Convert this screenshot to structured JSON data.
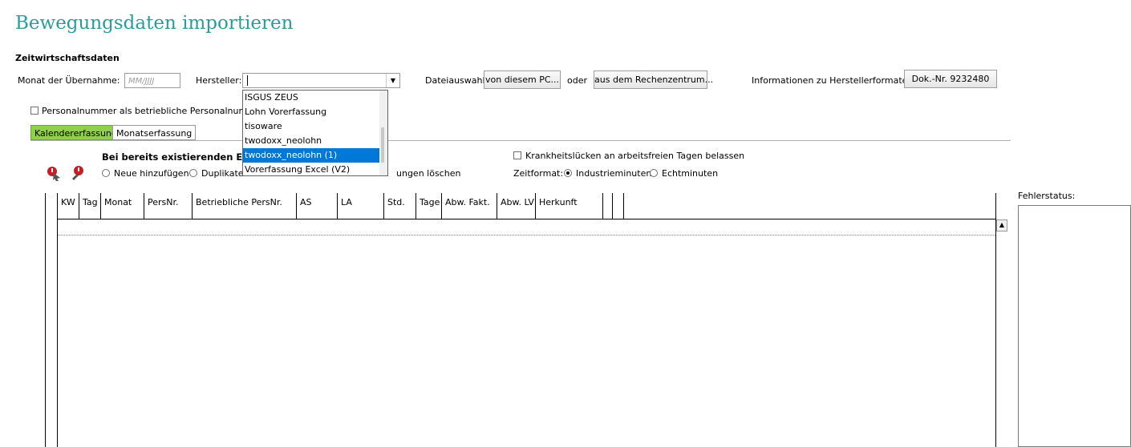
{
  "page": {
    "title": "Bewegungsdaten importieren",
    "section": "Zeitwirtschaftsdaten"
  },
  "form": {
    "month_label": "Monat der Übernahme:",
    "month_placeholder": "MM/JJJJ",
    "manufacturer_label": "Hersteller:",
    "file_label": "Dateiauswahl:",
    "from_pc_button": "von diesem PC...",
    "or_label": "oder",
    "from_datacenter_button": "aus dem Rechenzentrum...",
    "info_label": "Informationen zu Herstellerformaten:",
    "doc_button": "Dok.-Nr. 9232480",
    "persnr_checkbox": "Personalnummer als betriebliche Personalnummer imp"
  },
  "dropdown": {
    "items": [
      "ISGUS ZEUS",
      "Lohn Vorerfassung",
      "tisoware",
      "twodoxx_neolohn",
      "twodoxx_neolohn (1)",
      "Vorerfassung Excel (V2)"
    ],
    "selected_index": 4
  },
  "tabs": [
    {
      "label": "Kalendererfassung",
      "active": true
    },
    {
      "label": "Monatserfassung",
      "active": false
    }
  ],
  "options": {
    "heading": "Bei bereits existierenden Erfass",
    "radio_new": "Neue hinzufügen",
    "radio_dup": "Duplikate v",
    "radio_delete_tail": "ungen löschen",
    "sick_checkbox": "Krankheitslücken an arbeitsfreien Tagen belassen",
    "timeformat_label": "Zeitformat:",
    "radio_industrial": "Industrieminuten",
    "radio_real": "Echtminuten"
  },
  "table": {
    "columns": [
      "KW",
      "Tag",
      "Monat",
      "PersNr.",
      "Betriebliche PersNr.",
      "AS",
      "LA",
      "Std.",
      "Tage",
      "Abw. Fakt.",
      "Abw. LV",
      "Herkunft",
      "",
      ""
    ]
  },
  "error_panel": {
    "label": "Fehlerstatus:"
  },
  "colors": {
    "title": "#2a9d9a",
    "active_tab": "#8fcf4a",
    "selection": "#0078d7"
  },
  "icons": [
    "import-red-icon",
    "delete-red-icon",
    "scroll-up-icon"
  ]
}
